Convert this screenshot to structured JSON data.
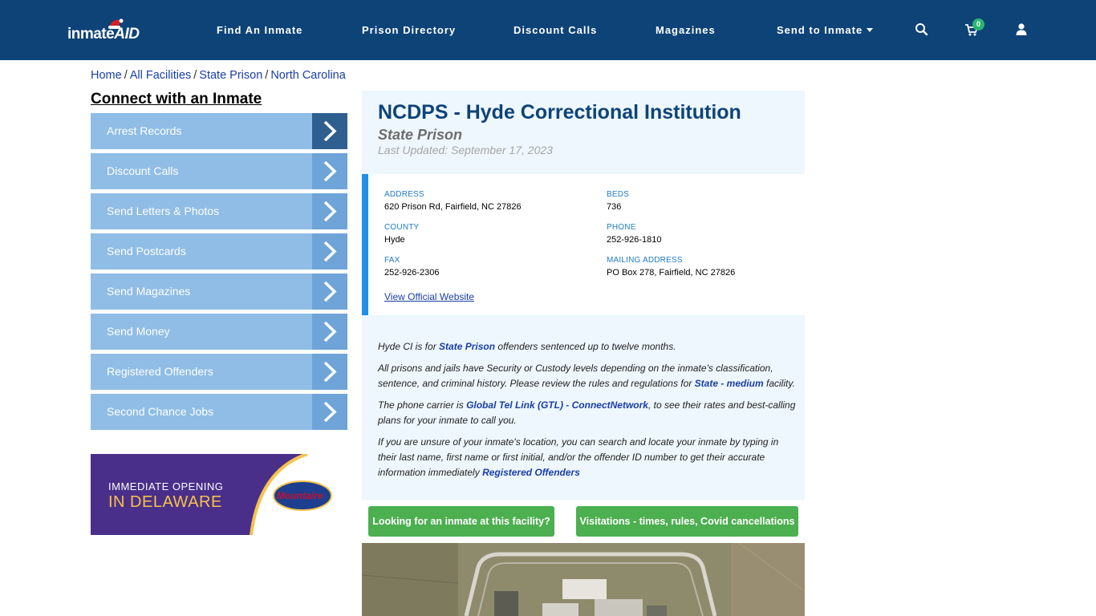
{
  "nav": {
    "logo_main": "inmate",
    "logo_aid": "AID",
    "links": [
      {
        "label": "Find An Inmate"
      },
      {
        "label": "Prison Directory"
      },
      {
        "label": "Discount Calls"
      },
      {
        "label": "Magazines"
      },
      {
        "label": "Send to Inmate"
      }
    ],
    "cart_count": "0",
    "icons": [
      "search-icon",
      "cart-icon",
      "user-icon"
    ]
  },
  "breadcrumb": {
    "items": [
      "Home",
      "All Facilities",
      "State Prison",
      "North Carolina"
    ],
    "separator": "/"
  },
  "sidebar": {
    "title": "Connect with an Inmate",
    "items": [
      {
        "label": "Arrest Records"
      },
      {
        "label": "Discount Calls"
      },
      {
        "label": "Send Letters & Photos"
      },
      {
        "label": "Send Postcards"
      },
      {
        "label": "Send Magazines"
      },
      {
        "label": "Send Money"
      },
      {
        "label": "Registered Offenders"
      },
      {
        "label": "Second Chance Jobs"
      }
    ]
  },
  "ad": {
    "line1": "IMMEDIATE OPENING",
    "line2": "IN DELAWARE",
    "brand": "Mountaire"
  },
  "facility": {
    "title": "NCDPS - Hyde Correctional Institution",
    "type": "State Prison",
    "updated": "Last Updated: September 17, 2023",
    "fields": {
      "address_label": "ADDRESS",
      "address": "620 Prison Rd, Fairfield, NC 27826",
      "beds_label": "BEDS",
      "beds": "736",
      "county_label": "COUNTY",
      "county": "Hyde",
      "phone_label": "PHONE",
      "phone": "252-926-1810",
      "fax_label": "FAX",
      "fax": "252-926-2306",
      "mailing_label": "MAILING ADDRESS",
      "mailing": "PO Box 278, Fairfield, NC 27826"
    },
    "website_link": "View Official Website"
  },
  "description": {
    "p1_a": "Hyde CI is for ",
    "p1_kw": "State Prison",
    "p1_b": " offenders sentenced up to twelve months.",
    "p2_a": "All prisons and jails have Security or Custody levels depending on the inmate's classification, sentence, and criminal history. Please review the rules and regulations for ",
    "p2_kw": "State - medium",
    "p2_b": " facility.",
    "p3_a": "The phone carrier is ",
    "p3_kw": "Global Tel Link (GTL) - ConnectNetwork",
    "p3_b": ", to see their rates and best-calling plans for your inmate to call you.",
    "p4_a": "If you are unsure of your inmate's location, you can search and locate your inmate by typing in their last name, first name or first initial, and/or the offender ID number to get their accurate information immediately ",
    "p4_kw": "Registered Offenders"
  },
  "buttons": {
    "looking": "Looking for an inmate at this facility?",
    "visitations": "Visitations - times, rules, Covid cancellations"
  },
  "colors": {
    "nav_bg": "#0e4378",
    "sidebar_item": "#8fbde6",
    "sidebar_arrow": "#6ea4d8",
    "accent_blue": "#1e90e6",
    "button_green": "#4caf50",
    "panel_bg": "#edf7fd"
  }
}
